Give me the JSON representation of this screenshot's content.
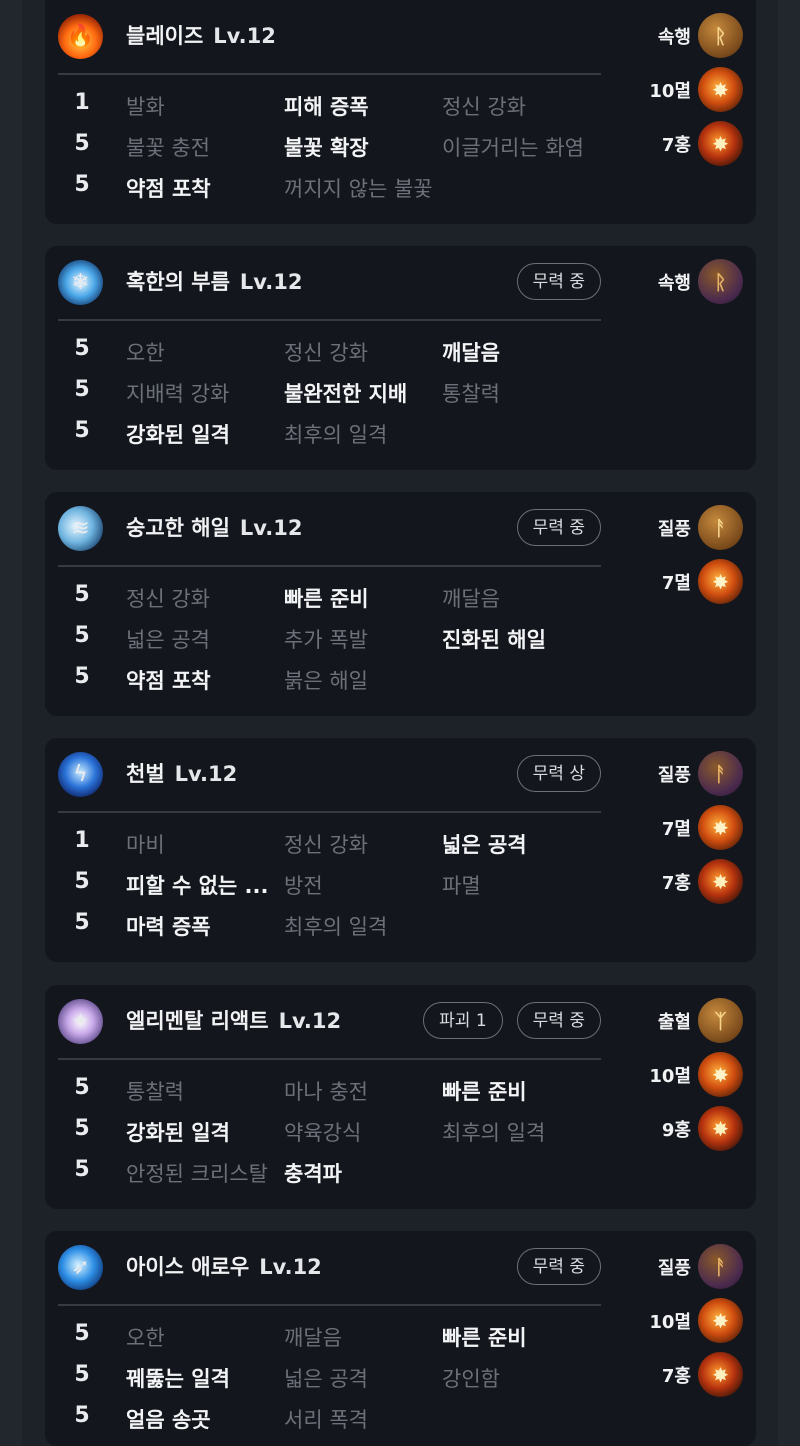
{
  "cards": [
    {
      "name": "블레이즈",
      "level": "Lv.12",
      "badges": [],
      "icon": "flame-icon",
      "rows": [
        {
          "lvl": "1",
          "opts": [
            {
              "t": "발화",
              "on": false
            },
            {
              "t": "피해 증폭",
              "on": true
            },
            {
              "t": "정신 강화",
              "on": false
            }
          ]
        },
        {
          "lvl": "5",
          "opts": [
            {
              "t": "불꽃 충전",
              "on": false
            },
            {
              "t": "불꽃 확장",
              "on": true
            },
            {
              "t": "이글거리는 화염",
              "on": false
            }
          ]
        },
        {
          "lvl": "5",
          "opts": [
            {
              "t": "약점 포착",
              "on": true
            },
            {
              "t": "꺼지지 않는 불꽃",
              "on": false
            }
          ]
        }
      ],
      "gems": [
        {
          "label": "속행",
          "type": "rune",
          "glyph": "ᚱ"
        },
        {
          "label": "10멸",
          "type": "fire",
          "glyph": "✸"
        },
        {
          "label": "7홍",
          "type": "fire2",
          "glyph": "✸"
        }
      ]
    },
    {
      "name": "혹한의 부름",
      "level": "Lv.12",
      "badges": [
        "무력 중"
      ],
      "icon": "snowflake-icon",
      "rows": [
        {
          "lvl": "5",
          "opts": [
            {
              "t": "오한",
              "on": false
            },
            {
              "t": "정신 강화",
              "on": false
            },
            {
              "t": "깨달음",
              "on": true
            }
          ]
        },
        {
          "lvl": "5",
          "opts": [
            {
              "t": "지배력 강화",
              "on": false
            },
            {
              "t": "불완전한 지배",
              "on": true
            },
            {
              "t": "통찰력",
              "on": false
            }
          ]
        },
        {
          "lvl": "5",
          "opts": [
            {
              "t": "강화된 일격",
              "on": true
            },
            {
              "t": "최후의 일격",
              "on": false
            }
          ]
        }
      ],
      "gems": [
        {
          "label": "속행",
          "type": "rune-purple",
          "glyph": "ᚱ"
        }
      ]
    },
    {
      "name": "숭고한 해일",
      "level": "Lv.12",
      "badges": [
        "무력 중"
      ],
      "icon": "wave-icon",
      "rows": [
        {
          "lvl": "5",
          "opts": [
            {
              "t": "정신 강화",
              "on": false
            },
            {
              "t": "빠른 준비",
              "on": true
            },
            {
              "t": "깨달음",
              "on": false
            }
          ]
        },
        {
          "lvl": "5",
          "opts": [
            {
              "t": "넓은 공격",
              "on": false
            },
            {
              "t": "추가 폭발",
              "on": false
            },
            {
              "t": "진화된 해일",
              "on": true
            }
          ]
        },
        {
          "lvl": "5",
          "opts": [
            {
              "t": "약점 포착",
              "on": true
            },
            {
              "t": "붉은 해일",
              "on": false
            }
          ]
        }
      ],
      "gems": [
        {
          "label": "질풍",
          "type": "rune",
          "glyph": "ᚨ"
        },
        {
          "label": "7멸",
          "type": "fire",
          "glyph": "✸"
        }
      ]
    },
    {
      "name": "천벌",
      "level": "Lv.12",
      "badges": [
        "무력 상"
      ],
      "icon": "lightning-icon",
      "rows": [
        {
          "lvl": "1",
          "opts": [
            {
              "t": "마비",
              "on": false
            },
            {
              "t": "정신 강화",
              "on": false
            },
            {
              "t": "넓은 공격",
              "on": true
            }
          ]
        },
        {
          "lvl": "5",
          "opts": [
            {
              "t": "피할 수 없는 ...",
              "on": true
            },
            {
              "t": "방전",
              "on": false
            },
            {
              "t": "파멸",
              "on": false
            }
          ]
        },
        {
          "lvl": "5",
          "opts": [
            {
              "t": "마력 증폭",
              "on": true
            },
            {
              "t": "최후의 일격",
              "on": false
            }
          ]
        }
      ],
      "gems": [
        {
          "label": "질풍",
          "type": "rune-purple",
          "glyph": "ᚨ"
        },
        {
          "label": "7멸",
          "type": "fire",
          "glyph": "✸"
        },
        {
          "label": "7홍",
          "type": "fire2",
          "glyph": "✸"
        }
      ]
    },
    {
      "name": "엘리멘탈 리액트",
      "level": "Lv.12",
      "badges": [
        "파괴 1",
        "무력 중"
      ],
      "icon": "crystal-icon",
      "rows": [
        {
          "lvl": "5",
          "opts": [
            {
              "t": "통찰력",
              "on": false
            },
            {
              "t": "마나 충전",
              "on": false
            },
            {
              "t": "빠른 준비",
              "on": true
            }
          ]
        },
        {
          "lvl": "5",
          "opts": [
            {
              "t": "강화된 일격",
              "on": true
            },
            {
              "t": "약육강식",
              "on": false
            },
            {
              "t": "최후의 일격",
              "on": false
            }
          ]
        },
        {
          "lvl": "5",
          "opts": [
            {
              "t": "안정된 크리스탈",
              "on": false
            },
            {
              "t": "충격파",
              "on": true
            }
          ]
        }
      ],
      "gems": [
        {
          "label": "출혈",
          "type": "rune",
          "glyph": "ᛉ"
        },
        {
          "label": "10멸",
          "type": "fire",
          "glyph": "✸"
        },
        {
          "label": "9홍",
          "type": "fire2",
          "glyph": "✸"
        }
      ]
    },
    {
      "name": "아이스 애로우",
      "level": "Lv.12",
      "badges": [
        "무력 중"
      ],
      "icon": "ice-arrow-icon",
      "rows": [
        {
          "lvl": "5",
          "opts": [
            {
              "t": "오한",
              "on": false
            },
            {
              "t": "깨달음",
              "on": false
            },
            {
              "t": "빠른 준비",
              "on": true
            }
          ]
        },
        {
          "lvl": "5",
          "opts": [
            {
              "t": "꿰뚫는 일격",
              "on": true
            },
            {
              "t": "넓은 공격",
              "on": false
            },
            {
              "t": "강인함",
              "on": false
            }
          ]
        },
        {
          "lvl": "5",
          "opts": [
            {
              "t": "얼음 송곳",
              "on": true
            },
            {
              "t": "서리 폭격",
              "on": false
            }
          ]
        }
      ],
      "gems": [
        {
          "label": "질풍",
          "type": "rune-purple",
          "glyph": "ᚨ"
        },
        {
          "label": "10멸",
          "type": "fire",
          "glyph": "✸"
        },
        {
          "label": "7홍",
          "type": "fire2",
          "glyph": "✸"
        }
      ]
    }
  ],
  "icon_styles": {
    "flame-icon": {
      "bg": "radial-gradient(circle at 50% 60%, #ffd04a, #ff6a10 45%, #8a1d05 80%)",
      "glyph": "🔥"
    },
    "snowflake-icon": {
      "bg": "radial-gradient(circle at 50% 50%, #e8f6ff, #4aa7e8 45%, #0d2f63 85%)",
      "glyph": "❄"
    },
    "wave-icon": {
      "bg": "radial-gradient(circle at 40% 45%, #e7f6ff, #6fb4e0 45%, #123a66 85%)",
      "glyph": "≋"
    },
    "lightning-icon": {
      "bg": "radial-gradient(circle at 50% 45%, #c9ecff, #2b73d9 45%, #0a1a5a 85%)",
      "glyph": "ϟ"
    },
    "crystal-icon": {
      "bg": "radial-gradient(circle at 50% 50%, #ffffff, #c9a9e9 40%, #4b3a7a 85%)",
      "glyph": "✦"
    },
    "ice-arrow-icon": {
      "bg": "radial-gradient(circle at 45% 45%, #d8f4ff, #2e8fe6 45%, #0b2a6a 85%)",
      "glyph": "➶"
    }
  }
}
